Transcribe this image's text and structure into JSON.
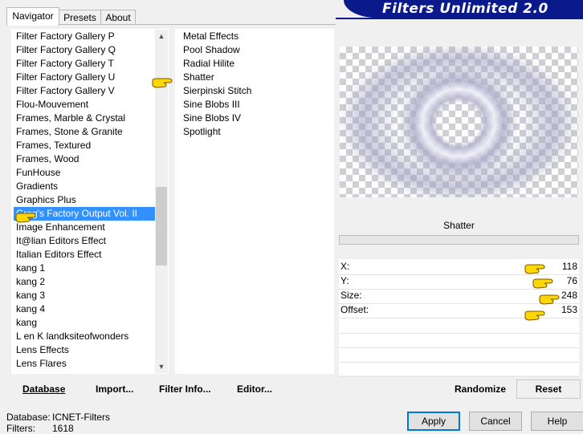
{
  "app": {
    "banner_title": "Filters Unlimited 2.0"
  },
  "tabs": [
    {
      "label": "Navigator",
      "active": true
    },
    {
      "label": "Presets",
      "active": false
    },
    {
      "label": "About",
      "active": false
    }
  ],
  "categories": {
    "items": [
      "Filter Factory Gallery P",
      "Filter Factory Gallery Q",
      "Filter Factory Gallery T",
      "Filter Factory Gallery U",
      "Filter Factory Gallery V",
      "Flou-Mouvement",
      "Frames, Marble & Crystal",
      "Frames, Stone & Granite",
      "Frames, Textured",
      "Frames, Wood",
      "FunHouse",
      "Gradients",
      "Graphics Plus",
      "Greg's Factory Output Vol. II",
      "Image Enhancement",
      "It@lian Editors Effect",
      "Italian Editors Effect",
      "kang 1",
      "kang 2",
      "kang 3",
      "kang 4",
      "kang",
      "L en K landksiteofwonders",
      "Lens Effects",
      "Lens Flares"
    ],
    "selected_index": 13
  },
  "filters": {
    "items": [
      "Metal Effects",
      "Pool Shadow",
      "Radial Hilite",
      "Shatter",
      "Sierpinski Stitch",
      "Sine Blobs III",
      "Sine Blobs IV",
      "Spotlight"
    ],
    "selected_index": 3
  },
  "preview": {
    "filter_name": "Shatter"
  },
  "params": [
    {
      "label": "X:",
      "value": "118"
    },
    {
      "label": "Y:",
      "value": "76"
    },
    {
      "label": "Size:",
      "value": "248"
    },
    {
      "label": "Offset:",
      "value": "153"
    }
  ],
  "toolbar": {
    "database": "Database",
    "import": "Import...",
    "filter_info": "Filter Info...",
    "editor": "Editor...",
    "randomize": "Randomize",
    "reset": "Reset"
  },
  "footer": {
    "database_label": "Database:",
    "database_value": "ICNET-Filters",
    "filters_label": "Filters:",
    "filters_value": "1618",
    "apply": "Apply",
    "cancel": "Cancel",
    "help": "Help"
  },
  "colors": {
    "banner": "#0a1a8a",
    "selection": "#3390ff",
    "pointer_hand": "#ffd700"
  },
  "icons": [
    "pointer-hand-icon",
    "scroll-up-icon",
    "scroll-down-icon"
  ]
}
